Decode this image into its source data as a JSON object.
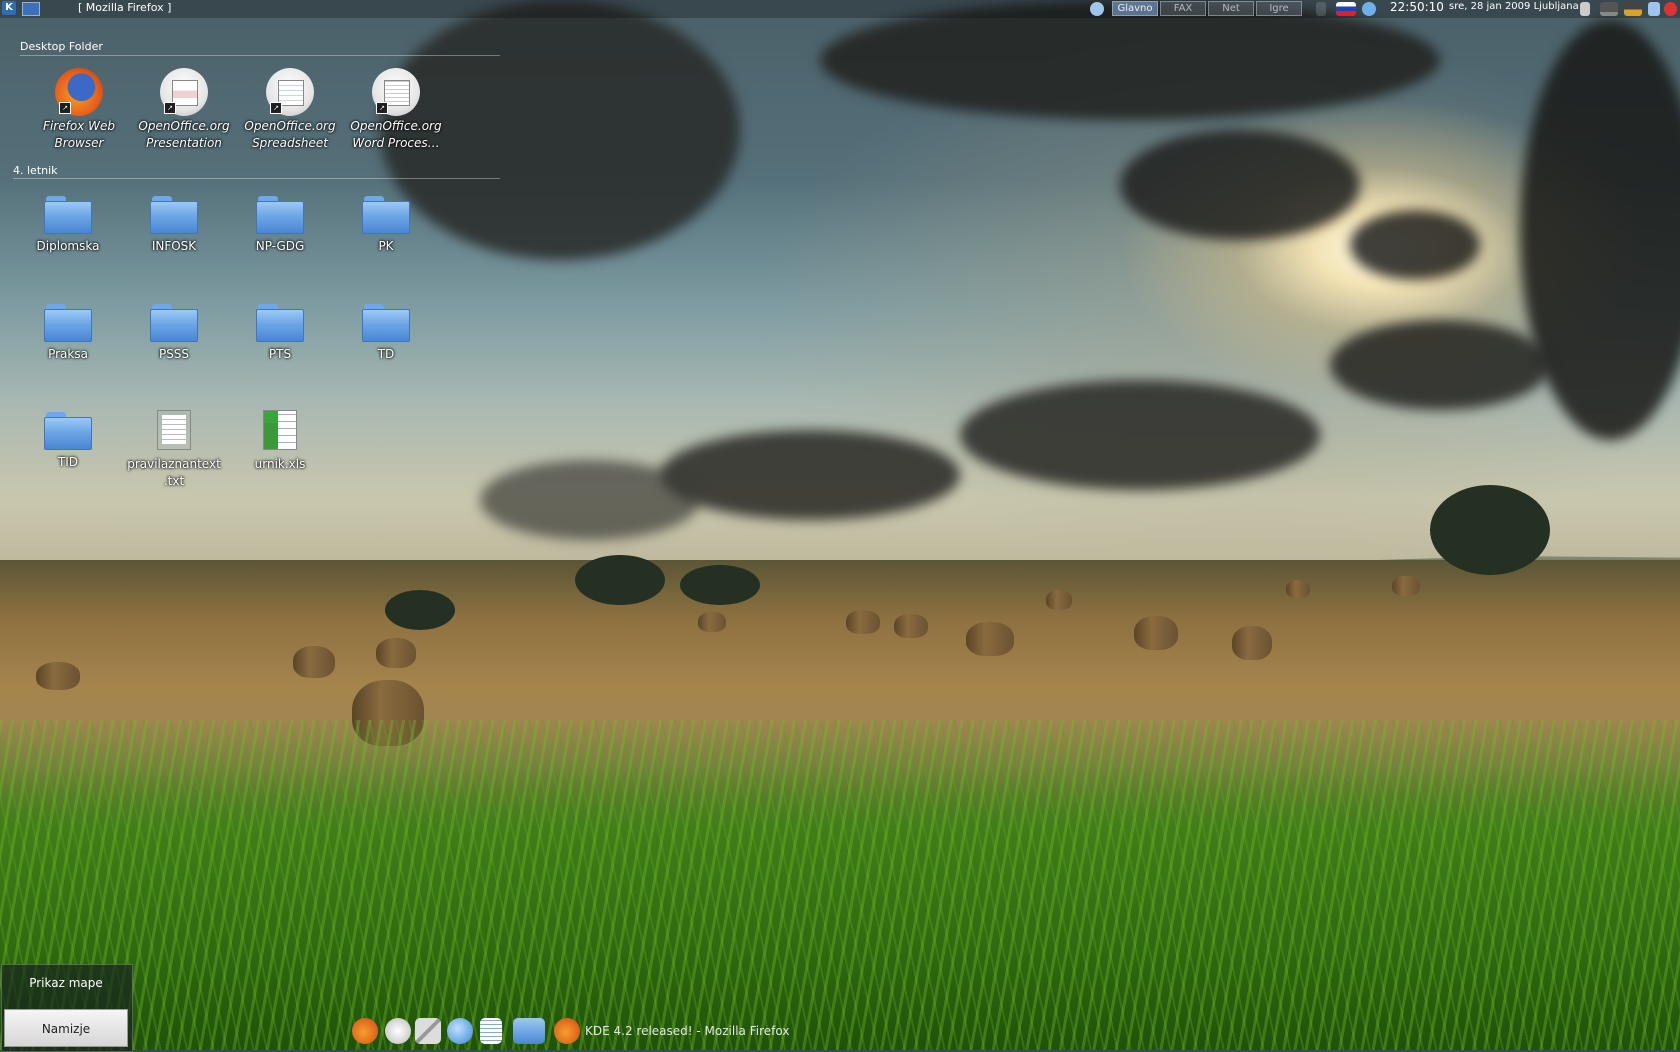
{
  "top_panel": {
    "window_title": "[ Mozilla Firefox ]",
    "pager": [
      "Glavno",
      "FAX",
      "Net",
      "Igre"
    ],
    "clock": "22:50:10",
    "date": "sre, 28 jan 2009 Ljubljana"
  },
  "folder_view": {
    "title": "Desktop Folder",
    "apps": [
      {
        "line1": "Firefox Web",
        "line2": "Browser",
        "icon": "firefox-icon"
      },
      {
        "line1": "OpenOffice.org",
        "line2": "Presentation",
        "icon": "impress-icon"
      },
      {
        "line1": "OpenOffice.org",
        "line2": "Spreadsheet",
        "icon": "calc-icon"
      },
      {
        "line1": "OpenOffice.org",
        "line2": "Word Proces…",
        "icon": "writer-icon"
      }
    ],
    "group_title": "4. letnik",
    "items": [
      "Diplomska",
      "INFOSK",
      "NP-GDG",
      "PK",
      "Praksa",
      "PSSS",
      "PTS",
      "TD",
      "TID",
      "pravilaznantext",
      ".txt",
      "urnik.xls"
    ]
  },
  "dashboard": {
    "show_folder": "Prikaz mape",
    "desktop": "Namizje"
  },
  "taskbar": {
    "active_task": "KDE 4.2 released! - Mozilla Firefox"
  },
  "colors": {
    "folder_blue": "#6da6e6",
    "panel_bg": "#000000"
  }
}
